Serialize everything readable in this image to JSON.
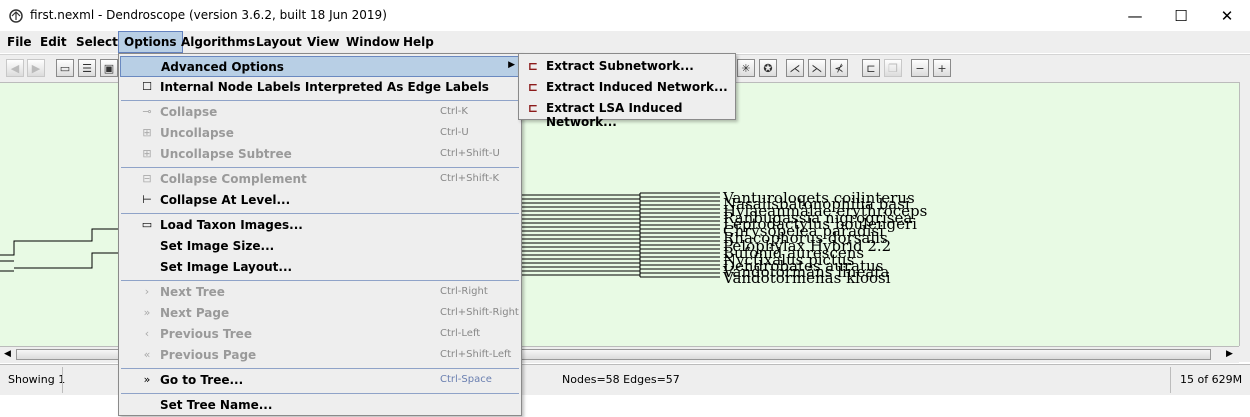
{
  "window": {
    "title": "first.nexml - Dendroscope (version 3.6.2, built 18 Jun 2019)",
    "minimize": "—",
    "maximize": "☐",
    "close": "✕"
  },
  "menubar": {
    "items": [
      "File",
      "Edit",
      "Select",
      "Options",
      "Algorithms",
      "Layout",
      "View",
      "Window",
      "Help"
    ],
    "active": "Options"
  },
  "options_menu": {
    "items": [
      {
        "label": "Advanced Options",
        "accel": "",
        "enabled": true,
        "icon": "",
        "submenu": true
      },
      {
        "label": "Internal Node Labels Interpreted As Edge Labels",
        "accel": "",
        "enabled": true,
        "icon": "checkbox-icon"
      },
      {
        "label": "Collapse",
        "accel": "Ctrl-K",
        "enabled": false,
        "icon": "collapse-icon"
      },
      {
        "label": "Uncollapse",
        "accel": "Ctrl-U",
        "enabled": false,
        "icon": "uncollapse-icon"
      },
      {
        "label": "Uncollapse Subtree",
        "accel": "Ctrl+Shift-U",
        "enabled": false,
        "icon": ""
      },
      {
        "label": "Collapse Complement",
        "accel": "Ctrl+Shift-K",
        "enabled": false,
        "icon": ""
      },
      {
        "label": "Collapse At Level...",
        "accel": "",
        "enabled": true,
        "icon": "collapse-level-icon"
      },
      {
        "label": "Load Taxon Images...",
        "accel": "",
        "enabled": true,
        "icon": "folder-icon"
      },
      {
        "label": "Set Image Size...",
        "accel": "",
        "enabled": true,
        "icon": ""
      },
      {
        "label": "Set Image Layout...",
        "accel": "",
        "enabled": true,
        "icon": ""
      },
      {
        "label": "Next Tree",
        "accel": "Ctrl-Right",
        "enabled": false,
        "icon": "next-icon"
      },
      {
        "label": "Next Page",
        "accel": "Ctrl+Shift-Right",
        "enabled": false,
        "icon": "next-page-icon"
      },
      {
        "label": "Previous Tree",
        "accel": "Ctrl-Left",
        "enabled": false,
        "icon": "previous-icon"
      },
      {
        "label": "Previous Page",
        "accel": "Ctrl+Shift-Left",
        "enabled": false,
        "icon": "previous-page-icon"
      },
      {
        "label": "Go to Tree...",
        "accel": "Ctrl-Space",
        "enabled": true,
        "icon": "goto-icon"
      },
      {
        "label": "Set Tree Name...",
        "accel": "",
        "enabled": true,
        "icon": ""
      }
    ]
  },
  "advanced_submenu": {
    "items": [
      "Extract Subnetwork...",
      "Extract Induced Network...",
      "Extract LSA Induced Network..."
    ]
  },
  "status": {
    "showing": "Showing 1",
    "nodes_edges": "Nodes=58 Edges=57",
    "memory": "15 of 629M"
  },
  "tree_labels": [
    "Vanturoloqets coilinterus",
    "Nasalisbatonophilia basi",
    "Hylaeanmalae erythroceps",
    "Ranbugassia nigrogrisea",
    "Leptodactylus boulengeri",
    "Chrysopelea paradisi",
    "Pelophylax Hybrid 2.2",
    "Rhacophorus dorsalis",
    "Bufonid aurescens",
    "Nyctixalus pictus",
    "Dendrobates auratus",
    "Vandotormans lineata",
    "Vandotormenas kloosi"
  ]
}
